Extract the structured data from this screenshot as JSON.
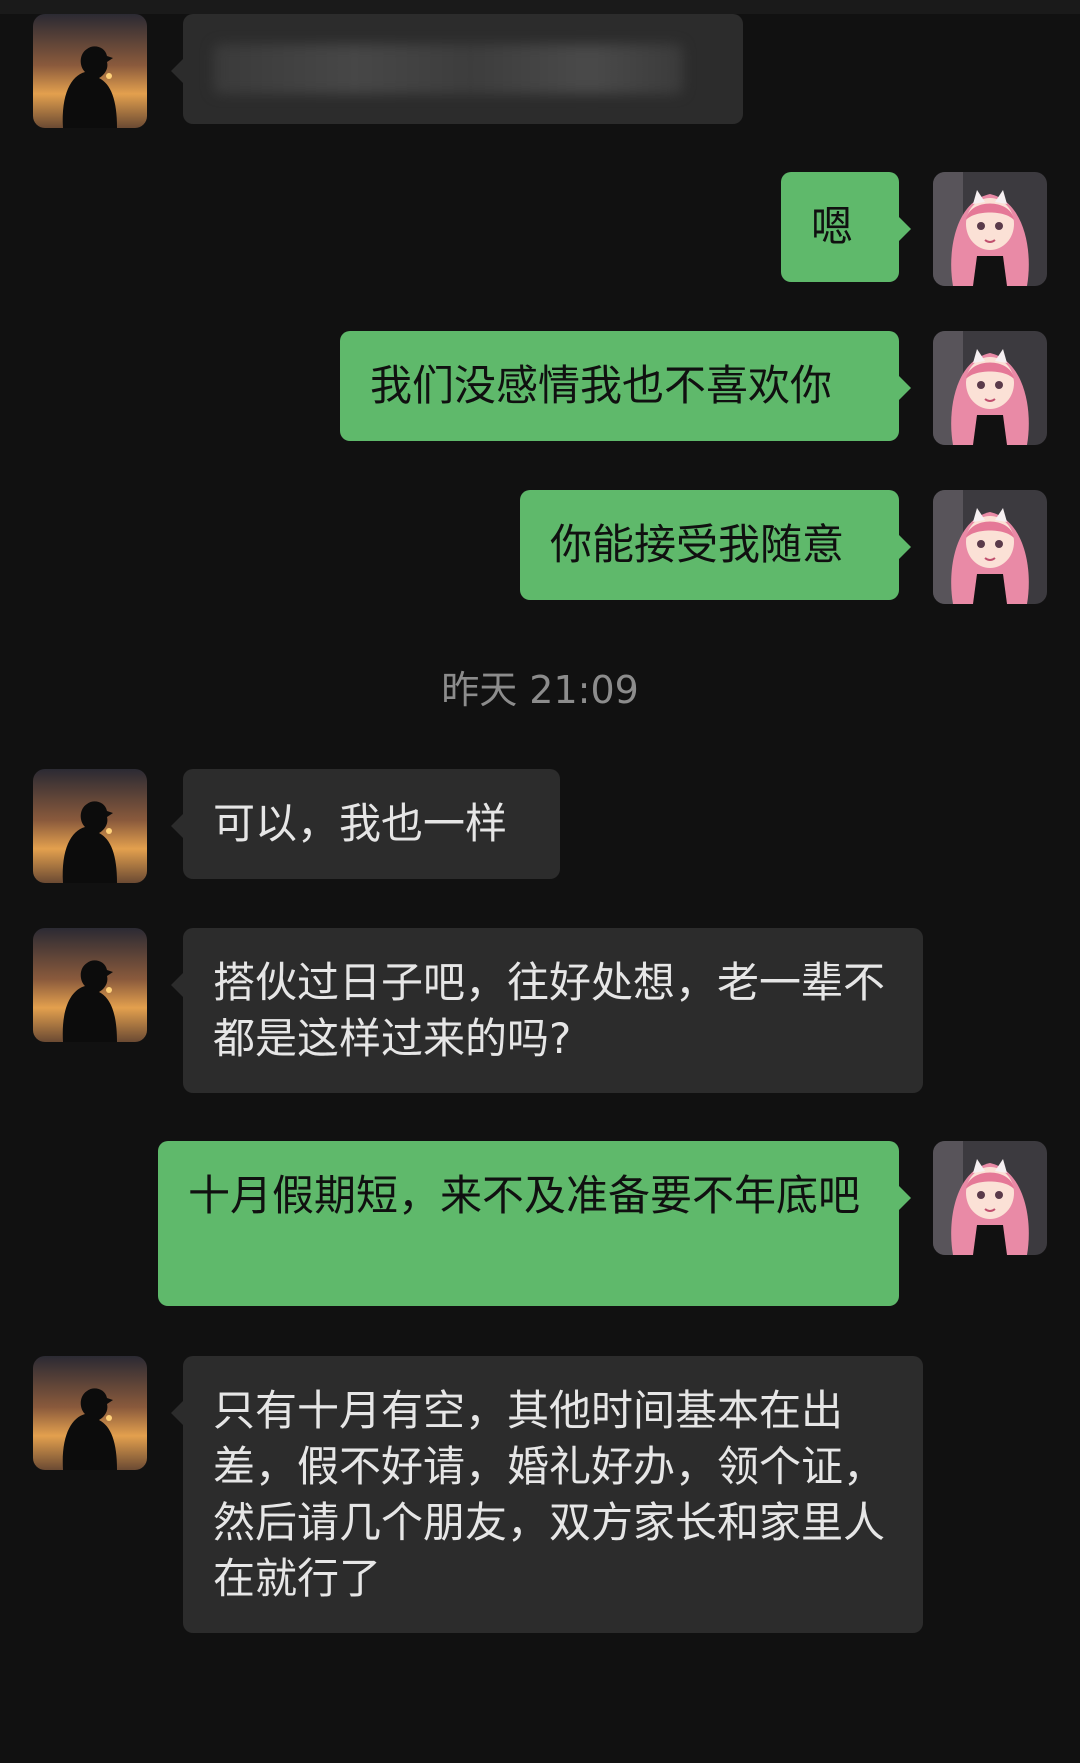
{
  "chat": {
    "messages": [
      {
        "side": "left",
        "text": ""
      },
      {
        "side": "right",
        "text": "嗯"
      },
      {
        "side": "right",
        "text": "我们没感情我也不喜欢你"
      },
      {
        "side": "right",
        "text": "你能接受我随意"
      },
      {
        "side": "left",
        "text": "可以，我也一样"
      },
      {
        "side": "left",
        "text": "搭伙过日子吧，往好处想，老一辈不都是这样过来的吗?"
      },
      {
        "side": "right",
        "text": "十月假期短，来不及准备要不年底吧"
      },
      {
        "side": "left",
        "text": "只有十月有空，其他时间基本在出差，假不好请，婚礼好办，领个证，然后请几个朋友，双方家长和家里人在就行了"
      }
    ],
    "timestamp": "昨天 21:09"
  },
  "colors": {
    "background": "#111111",
    "incoming_bubble": "#2c2c2c",
    "outgoing_bubble": "#5fb96b",
    "timestamp_text": "#8c8c8c"
  },
  "icons": {
    "contact_avatar": "silhouette-sunset-avatar-icon",
    "self_avatar": "pink-hair-girl-avatar-icon"
  }
}
